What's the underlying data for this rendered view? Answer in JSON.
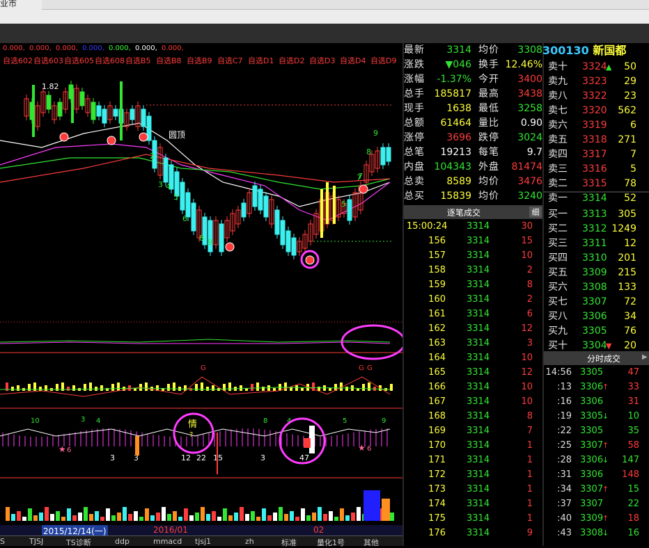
{
  "window": {
    "title_fragment": "业市"
  },
  "indicator_top": {
    "values": [
      "0.000,",
      "0.000,",
      "0.000,",
      "0.000,",
      "0.000,",
      "0.000,",
      "0.000,"
    ],
    "stock_list": [
      "自选602",
      "自选603",
      "自选605",
      "自选608",
      "自选B5",
      "自选B8",
      "自选B9",
      "自选C7",
      "自选D1",
      "自选D2",
      "自选D3",
      "自选D4",
      "自选D9"
    ]
  },
  "main_chart": {
    "high_label": "1.82",
    "pattern_label": "圆顶",
    "digits": [
      "2",
      "3",
      "4",
      "5",
      "6",
      "8",
      "9",
      "7",
      "9",
      "8",
      "5",
      "7"
    ]
  },
  "sub_chart": {
    "top_numbers": [
      "10",
      "3",
      "4",
      "8",
      "4",
      "5",
      "9"
    ],
    "bottom_numbers": [
      "3",
      "3",
      "12",
      "22",
      "15",
      "3",
      "47"
    ],
    "qing_label": "情",
    "question": "?",
    "g_labels": [
      "G",
      "G",
      "G"
    ],
    "star_labels": [
      "6",
      "6"
    ]
  },
  "date_bar": {
    "date1": "2015/12/14(一)",
    "date2": "2016/01",
    "date3": "02"
  },
  "bottom_tabs": [
    "S",
    "TJSJ",
    "TS诊断",
    "ddp",
    "mmacd",
    "tjsj1",
    "zh",
    "标准",
    "量化1号",
    "其他"
  ],
  "quote": {
    "rows": [
      {
        "k1": "最新",
        "v1": "3314",
        "c1": "cg",
        "k2": "均价",
        "v2": "3308",
        "c2": "cg"
      },
      {
        "k1": "涨跌",
        "v1": "▼046",
        "c1": "cg",
        "k2": "换手",
        "v2": "12.46%",
        "c2": "cy"
      },
      {
        "k1": "涨幅",
        "v1": "-1.37%",
        "c1": "cg",
        "k2": "今开",
        "v2": "3400",
        "c2": "cr"
      },
      {
        "k1": "总手",
        "v1": "185817",
        "c1": "cy",
        "k2": "最高",
        "v2": "3438",
        "c2": "cr"
      },
      {
        "k1": "现手",
        "v1": "1638",
        "c1": "cy",
        "k2": "最低",
        "v2": "3258",
        "c2": "cg"
      },
      {
        "k1": "总额",
        "v1": "61464",
        "c1": "cy",
        "k2": "量比",
        "v2": "0.90",
        "c2": "cw"
      },
      {
        "k1": "涨停",
        "v1": "3696",
        "c1": "cr",
        "k2": "跌停",
        "v2": "3024",
        "c2": "cg"
      },
      {
        "k1": "总笔",
        "v1": "19213",
        "c1": "cw",
        "k2": "每笔",
        "v2": "9.7",
        "c2": "cw"
      },
      {
        "k1": "内盘",
        "v1": "104343",
        "c1": "cg",
        "k2": "外盘",
        "v2": "81474",
        "c2": "cr"
      },
      {
        "k1": "总卖",
        "v1": "8589",
        "c1": "cy",
        "k2": "均价",
        "v2": "3476",
        "c2": "cr"
      },
      {
        "k1": "总买",
        "v1": "15839",
        "c1": "cy",
        "k2": "均价",
        "v2": "3240",
        "c2": "cg"
      }
    ]
  },
  "ticks": {
    "header": "逐笔成交",
    "detail_btn": "细",
    "rows": [
      {
        "t": "15:00:24",
        "p": "3314",
        "v": "30"
      },
      {
        "t": "156",
        "p": "3314",
        "v": "15"
      },
      {
        "t": "157",
        "p": "3314",
        "v": "10"
      },
      {
        "t": "158",
        "p": "3314",
        "v": "2"
      },
      {
        "t": "159",
        "p": "3314",
        "v": "8"
      },
      {
        "t": "160",
        "p": "3314",
        "v": "2"
      },
      {
        "t": "161",
        "p": "3314",
        "v": "6"
      },
      {
        "t": "162",
        "p": "3314",
        "v": "12"
      },
      {
        "t": "163",
        "p": "3314",
        "v": "3"
      },
      {
        "t": "164",
        "p": "3314",
        "v": "10"
      },
      {
        "t": "165",
        "p": "3314",
        "v": "12"
      },
      {
        "t": "166",
        "p": "3314",
        "v": "10"
      },
      {
        "t": "167",
        "p": "3314",
        "v": "10"
      },
      {
        "t": "168",
        "p": "3314",
        "v": "8"
      },
      {
        "t": "169",
        "p": "3314",
        "v": "7"
      },
      {
        "t": "170",
        "p": "3314",
        "v": "1"
      },
      {
        "t": "171",
        "p": "3314",
        "v": "1"
      },
      {
        "t": "172",
        "p": "3314",
        "v": "1"
      },
      {
        "t": "173",
        "p": "3314",
        "v": "1"
      },
      {
        "t": "174",
        "p": "3314",
        "v": "1"
      },
      {
        "t": "175",
        "p": "3314",
        "v": "1"
      },
      {
        "t": "176",
        "p": "3314",
        "v": "9"
      }
    ]
  },
  "stock": {
    "code": "300130",
    "name": "新国都"
  },
  "book": {
    "asks": [
      {
        "label": "卖十",
        "price": "3324",
        "arrow": "▲",
        "vol": "50",
        "c": "cr"
      },
      {
        "label": "卖九",
        "price": "3323",
        "arrow": "",
        "vol": "29",
        "c": "cr"
      },
      {
        "label": "卖八",
        "price": "3322",
        "arrow": "",
        "vol": "23",
        "c": "cr"
      },
      {
        "label": "卖七",
        "price": "3320",
        "arrow": "",
        "vol": "562",
        "c": "cr"
      },
      {
        "label": "卖六",
        "price": "3319",
        "arrow": "",
        "vol": "6",
        "c": "cr"
      },
      {
        "label": "卖五",
        "price": "3318",
        "arrow": "",
        "vol": "271",
        "c": "cr"
      },
      {
        "label": "卖四",
        "price": "3317",
        "arrow": "",
        "vol": "7",
        "c": "cr"
      },
      {
        "label": "卖三",
        "price": "3316",
        "arrow": "",
        "vol": "5",
        "c": "cr"
      },
      {
        "label": "卖二",
        "price": "3315",
        "arrow": "",
        "vol": "78",
        "c": "cr"
      },
      {
        "label": "卖一",
        "price": "3314",
        "arrow": "",
        "vol": "52",
        "c": "cg"
      }
    ],
    "bids": [
      {
        "label": "买一",
        "price": "3313",
        "arrow": "",
        "vol": "305",
        "c": "cg"
      },
      {
        "label": "买二",
        "price": "3312",
        "arrow": "",
        "vol": "1249",
        "c": "cg"
      },
      {
        "label": "买三",
        "price": "3311",
        "arrow": "",
        "vol": "12",
        "c": "cg"
      },
      {
        "label": "买四",
        "price": "3310",
        "arrow": "",
        "vol": "201",
        "c": "cg"
      },
      {
        "label": "买五",
        "price": "3309",
        "arrow": "",
        "vol": "215",
        "c": "cg"
      },
      {
        "label": "买六",
        "price": "3308",
        "arrow": "",
        "vol": "133",
        "c": "cg"
      },
      {
        "label": "买七",
        "price": "3307",
        "arrow": "",
        "vol": "72",
        "c": "cg"
      },
      {
        "label": "买八",
        "price": "3306",
        "arrow": "",
        "vol": "34",
        "c": "cg"
      },
      {
        "label": "买九",
        "price": "3305",
        "arrow": "",
        "vol": "76",
        "c": "cg"
      },
      {
        "label": "买十",
        "price": "3304",
        "arrow": "▼",
        "vol": "20",
        "c": "cg"
      }
    ]
  },
  "fenshi": {
    "header": "分时成交",
    "rows": [
      {
        "t": "14:56",
        "p": "3305",
        "a": "",
        "v": "47",
        "pc": "cg",
        "vc": "cr"
      },
      {
        "t": ":13",
        "p": "3306",
        "a": "↑",
        "v": "33",
        "pc": "cg",
        "vc": "cr"
      },
      {
        "t": ":16",
        "p": "3306",
        "a": "",
        "v": "31",
        "pc": "cg",
        "vc": "cr"
      },
      {
        "t": ":19",
        "p": "3305",
        "a": "↓",
        "v": "10",
        "pc": "cg",
        "vc": "cg"
      },
      {
        "t": ":22",
        "p": "3305",
        "a": "",
        "v": "35",
        "pc": "cg",
        "vc": "cg"
      },
      {
        "t": ":25",
        "p": "3307",
        "a": "↑",
        "v": "58",
        "pc": "cg",
        "vc": "cr"
      },
      {
        "t": ":28",
        "p": "3306",
        "a": "↓",
        "v": "147",
        "pc": "cg",
        "vc": "cg"
      },
      {
        "t": ":31",
        "p": "3306",
        "a": "",
        "v": "148",
        "pc": "cg",
        "vc": "cr"
      },
      {
        "t": ":34",
        "p": "3307",
        "a": "↑",
        "v": "15",
        "pc": "cg",
        "vc": "cg"
      },
      {
        "t": ":37",
        "p": "3307",
        "a": "",
        "v": "22",
        "pc": "cg",
        "vc": "cg"
      },
      {
        "t": ":40",
        "p": "3309",
        "a": "↑",
        "v": "18",
        "pc": "cg",
        "vc": "cr"
      },
      {
        "t": ":43",
        "p": "3308",
        "a": "↓",
        "v": "16",
        "pc": "cg",
        "vc": "cg"
      }
    ]
  }
}
